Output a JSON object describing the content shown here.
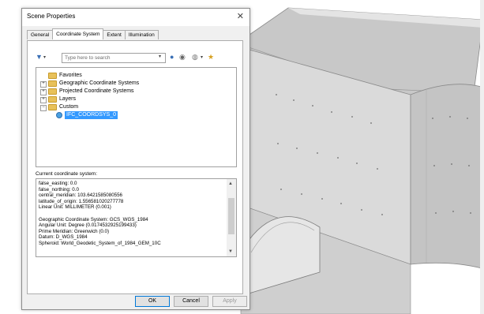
{
  "dialog": {
    "title": "Scene Properties",
    "close_glyph": "✕",
    "tabs": [
      {
        "label": "General",
        "active": false
      },
      {
        "label": "Coordinate System",
        "active": true
      },
      {
        "label": "Extent",
        "active": false
      },
      {
        "label": "Illumination",
        "active": false
      }
    ],
    "search": {
      "placeholder": "Type here to search"
    },
    "tree": {
      "favorites": "Favorites",
      "geographic": "Geographic Coordinate Systems",
      "projected": "Projected Coordinate Systems",
      "layers": "Layers",
      "custom": "Custom",
      "custom_child": "IFC_COORDSYS_0"
    },
    "current_label": "Current coordinate system:",
    "info_lines": [
      "false_easting: 0.0",
      "false_northing: 0.0",
      "central_meridian: 103.6421585080556",
      "latitude_of_origin: 1.556581020277778",
      "Linear Unit: MILLIMETER (0.001)",
      "",
      "Geographic Coordinate System: GCS_WGS_1984",
      "Angular Unit: Degree (0.0174532925199433)",
      "Prime Meridian: Greenwich (0.0)",
      "Datum: D_WGS_1984",
      "  Spheroid: World_Geodetic_System_of_1984_GEM_10C"
    ],
    "buttons": {
      "ok": "OK",
      "cancel": "Cancel",
      "apply": "Apply"
    }
  },
  "icons": {
    "filter": "filter-icon",
    "search": "search-icon",
    "clear": "clear-icon",
    "globe_menu": "globe-icon",
    "favorite": "add-favorite-icon"
  }
}
